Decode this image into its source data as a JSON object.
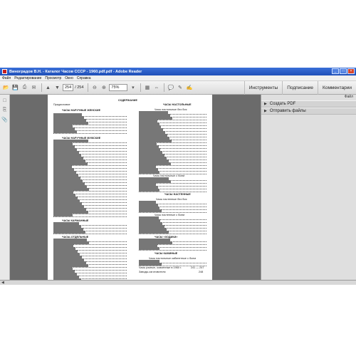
{
  "window": {
    "title": "Виноградов В.Н. - Каталог Часов СССР - 1960.pdf.pdf - Adobe Reader",
    "controls": {
      "minimize": "_",
      "maximize": "□",
      "close": "×"
    }
  },
  "menu": [
    "Файл",
    "Редактирование",
    "Просмотр",
    "Окно",
    "Справка"
  ],
  "toolbar": {
    "page_current": "254",
    "page_total": "/ 254",
    "zoom": "75%",
    "panels": [
      "Инструменты",
      "Подписание",
      "Комментарии"
    ]
  },
  "right_panel": {
    "heading": "Файл",
    "items": [
      "Создать PDF",
      "Отправить файлы"
    ]
  },
  "document": {
    "page_heading": "СОДЕРЖАНИЕ",
    "left_column": [
      "Предисловие",
      "ЧАСЫ НАРУЧНЫЕ ЖЕНСКИЕ",
      "ЧАСЫ НАРУЧНЫЕ МУЖСКИЕ",
      "ЧАСЫ КАРМАННЫЕ",
      "ЧАСЫ-ОТДЕЛЬНЫЕ"
    ],
    "right_column": [
      "ЧАСЫ НАСТОЛЬНЫЕ",
      "Часы настольные без боя",
      "Часы настольные с боем",
      "ЧАСЫ НАСТЕННЫЕ",
      "Часы настенные без боя",
      "Часы настенные с боем",
      "ЧАСЫ «ХОДИКИ»",
      "ЧАСЫ КАМИНЫЕ",
      "Часы настольные кабинетные с боем",
      "Часы разные, освоенные в 1960 г.",
      "Заводы-изготовители"
    ],
    "right_pages": [
      "241 — 247",
      "248"
    ]
  }
}
